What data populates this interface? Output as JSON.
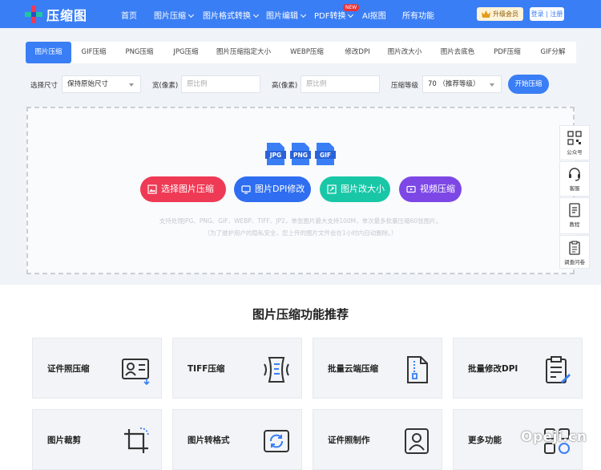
{
  "logo_text": "压缩图",
  "nav": [
    {
      "label": "首页",
      "chevron": false
    },
    {
      "label": "图片压缩",
      "chevron": true
    },
    {
      "label": "图片格式转换",
      "chevron": true
    },
    {
      "label": "图片编辑",
      "chevron": true
    },
    {
      "label": "PDF转换",
      "chevron": true
    },
    {
      "label": "AI抠图",
      "chevron": false
    },
    {
      "label": "所有功能",
      "chevron": false
    }
  ],
  "new_badge": "NEW",
  "vip_label": "升级会员",
  "login_label": "登录 | 注册",
  "tabs": [
    "图片压缩",
    "GIF压缩",
    "PNG压缩",
    "JPG压缩",
    "图片压缩指定大小",
    "WEBP压缩",
    "修改DPI",
    "图片改大小",
    "图片去底色",
    "PDF压缩",
    "GIF分解"
  ],
  "options": {
    "size_label": "选择尺寸",
    "size_value": "保持原始尺寸",
    "width_label": "宽(像素)",
    "width_placeholder": "原比例",
    "height_label": "高(像素)",
    "height_placeholder": "原比例",
    "level_label": "压缩等级",
    "level_value": "70 （推荐等级）",
    "start_label": "开始压缩"
  },
  "formats": [
    "JPG",
    "PNG",
    "GIF"
  ],
  "actions": [
    {
      "label": "选择图片压缩",
      "color": "#ef3a55"
    },
    {
      "label": "图片DPI修改",
      "color": "#2f6ef0"
    },
    {
      "label": "图片改大小",
      "color": "#19c7a7"
    },
    {
      "label": "视频压缩",
      "color": "#7d47e6"
    }
  ],
  "hint_line1": "支持处理JPG、PNG、GIF、WEBP、TIFF、JP2，单张图片最大支持100M，单次最多批量压缩60张图片。",
  "hint_line2": "（为了维护用户的隐私安全，您上传的图片文件会在1小时内自动删除。）",
  "side": [
    "公众号",
    "客服",
    "教程",
    "调查问卷"
  ],
  "section_title": "图片压缩功能推荐",
  "cards": [
    "证件照压缩",
    "TIFF压缩",
    "批量云端压缩",
    "批量修改DPI",
    "图片裁剪",
    "图片转格式",
    "证件照制作",
    "更多功能"
  ],
  "watermark": "Opeji.cn",
  "colors": {
    "brand": "#3a7ef5",
    "vip_bg": "#fff3d9"
  }
}
